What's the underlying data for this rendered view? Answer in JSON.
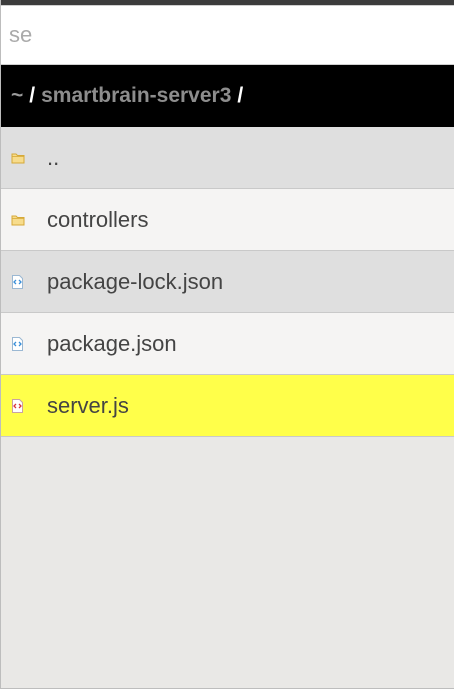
{
  "search": {
    "value": "",
    "placeholder": "se"
  },
  "path": {
    "home": "~",
    "separator": "/",
    "segments": [
      "smartbrain-server3"
    ]
  },
  "entries": [
    {
      "name": "..",
      "type": "folder",
      "icon": "folder-icon"
    },
    {
      "name": "controllers",
      "type": "folder",
      "icon": "folder-icon"
    },
    {
      "name": "package-lock.json",
      "type": "file",
      "icon": "json-file-icon"
    },
    {
      "name": "package.json",
      "type": "file",
      "icon": "json-file-icon"
    },
    {
      "name": "server.js",
      "type": "file",
      "icon": "js-file-icon",
      "selected": true
    }
  ],
  "colors": {
    "selected_row": "#ffff4a",
    "path_bar": "#000000",
    "folder_icon": "#f2c55c",
    "json_icon": "#3a8fd9",
    "js_icon": "#d9363a"
  }
}
